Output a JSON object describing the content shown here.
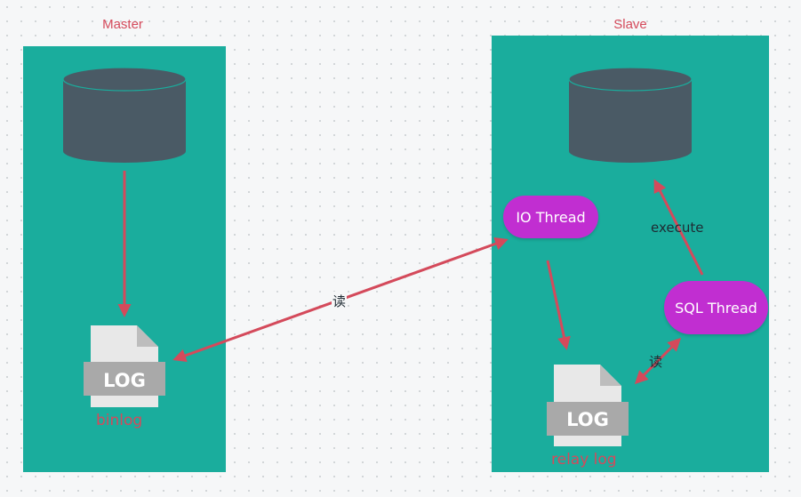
{
  "master": {
    "title": "Master",
    "log_badge": "LOG",
    "log_caption": "binlog"
  },
  "slave": {
    "title": "Slave",
    "log_badge": "LOG",
    "log_caption": "relay log",
    "io_thread": "IO Thread",
    "sql_thread": "SQL Thread"
  },
  "edges": {
    "io_read": "读",
    "sql_read": "读",
    "execute": "execute"
  },
  "colors": {
    "panel": "#1aad9d",
    "database": "#4a5a65",
    "thread": "#c12ed1",
    "arrow": "#d44a5b",
    "title_text": "#d44a5b"
  }
}
